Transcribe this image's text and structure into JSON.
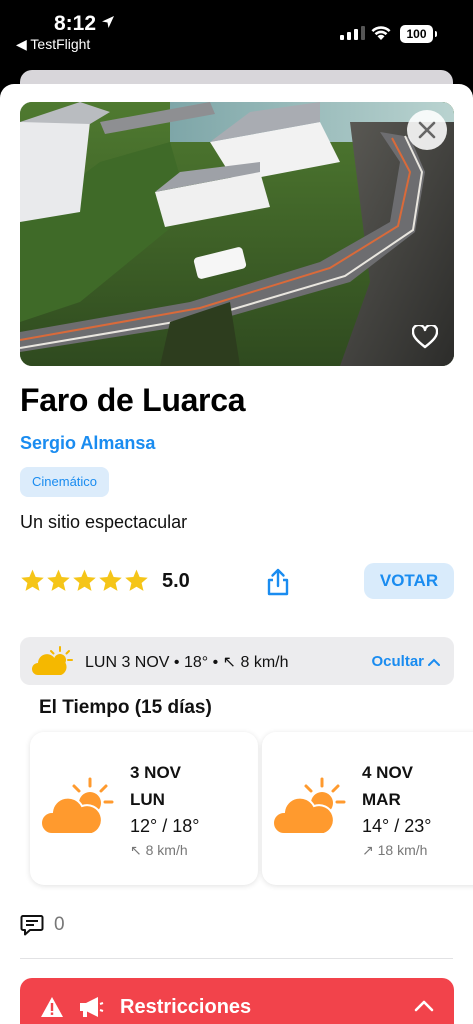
{
  "status_bar": {
    "time": "8:12",
    "back_app": "◀ TestFlight",
    "battery": "100"
  },
  "place": {
    "title": "Faro de Luarca",
    "author": "Sergio Almansa",
    "tag": "Cinemático",
    "description": "Un sitio espectacular",
    "rating": "5.0",
    "stars": 5,
    "vote_label": "VOTAR"
  },
  "weather_bar": {
    "summary": "LUN 3 NOV • 18° • ↖ 8 km/h",
    "hide_label": "Ocultar"
  },
  "forecast": {
    "title": "El Tiempo (15 días)",
    "days": [
      {
        "date": "3 NOV",
        "day": "LUN",
        "temp": "12° / 18°",
        "wind": "↖ 8 km/h"
      },
      {
        "date": "4 NOV",
        "day": "MAR",
        "temp": "14° / 23°",
        "wind": "↗ 18 km/h"
      }
    ]
  },
  "comments": {
    "count": "0"
  },
  "restrictions": {
    "label": "Restricciones"
  },
  "colors": {
    "accent": "#1a8cf0",
    "star": "#f5c518",
    "weather_orange": "#ff9a2e",
    "restrictions_red": "#f2434b"
  }
}
